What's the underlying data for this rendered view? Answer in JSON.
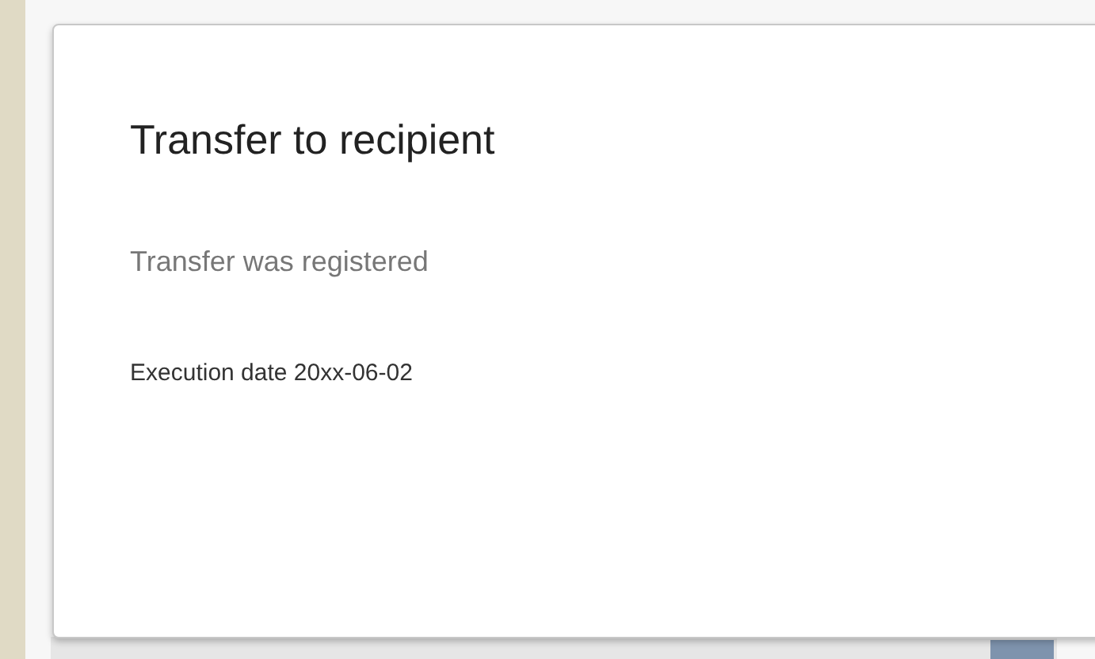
{
  "dialog": {
    "title": "Transfer to recipient",
    "status": "Transfer was registered",
    "execution_date": "Execution date 20xx-06-02"
  }
}
